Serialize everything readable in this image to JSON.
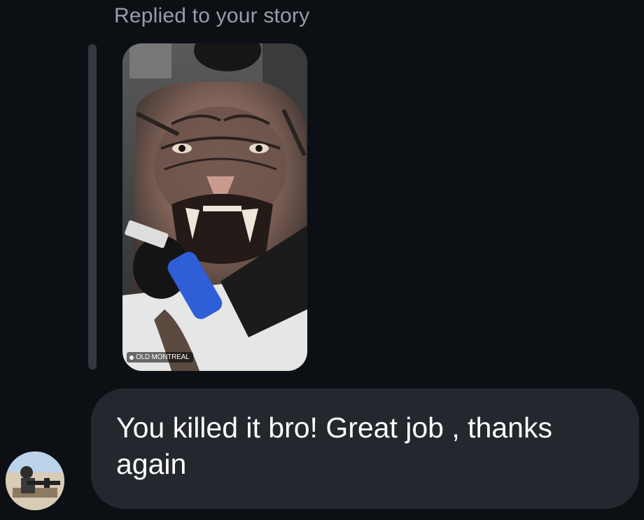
{
  "reply": {
    "caption": "Replied to your story"
  },
  "story": {
    "location_sticker": "OLD MONTREAL",
    "image_subject": "tiger-back-tattoo-photo"
  },
  "message": {
    "text": "You killed it bro! Great job , thanks\nagain"
  },
  "sender": {
    "avatar_icon": "avatar-photo-icon"
  },
  "colors": {
    "background": "#0c0f14",
    "bubble": "#24272d",
    "caption_text": "#9a9ea6",
    "message_text": "#ffffff",
    "reply_bar": "#34383f"
  }
}
